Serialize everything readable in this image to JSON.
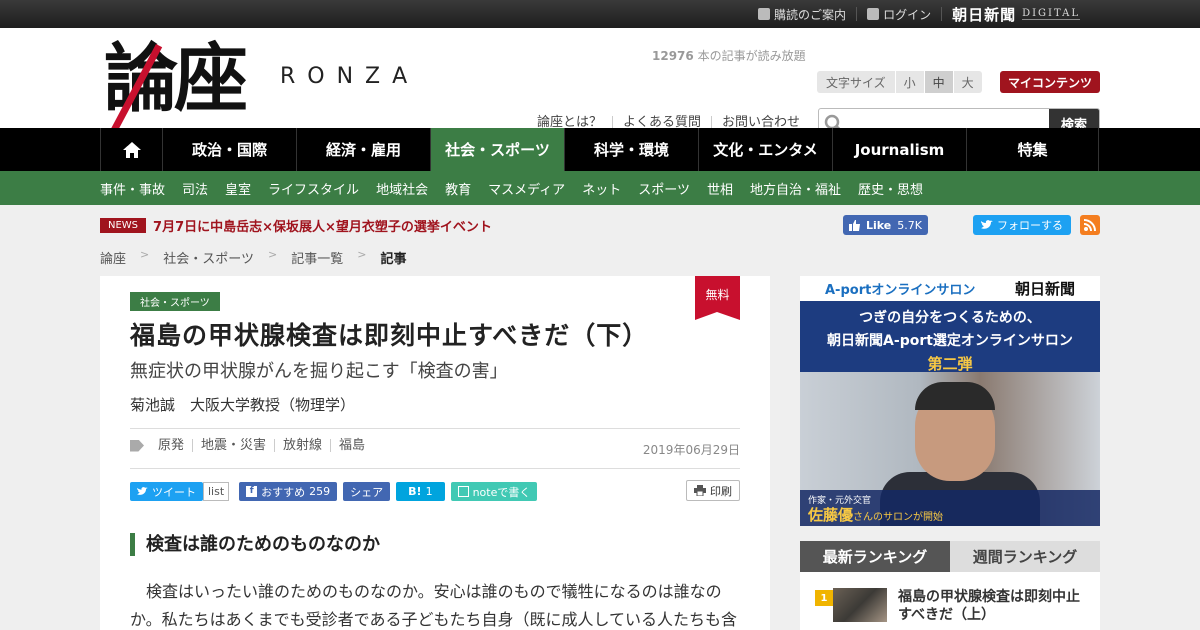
{
  "topbar": {
    "links": [
      "購読のご案内",
      "ログイン"
    ],
    "brand": "朝日新聞",
    "brand_sub": "DIGITAL"
  },
  "header": {
    "logo_kanji": "論座",
    "logo_latin": "RONZA",
    "read_count": "12976",
    "read_count_suffix": " 本の記事が読み放題",
    "font_size_label": "文字サイズ",
    "font_sizes": [
      "小",
      "中",
      "大"
    ],
    "font_size_selected": "中",
    "my_content": "マイコンテンツ",
    "help_links": [
      "論座とは？",
      "よくある質問",
      "お問い合わせ"
    ],
    "search_placeholder": "",
    "search_button": "検索"
  },
  "nav": {
    "items": [
      "政治・国際",
      "経済・雇用",
      "社会・スポーツ",
      "科学・環境",
      "文化・エンタメ",
      "Journalism",
      "特集"
    ],
    "active": "社会・スポーツ"
  },
  "subnav": {
    "items": [
      "事件・事故",
      "司法",
      "皇室",
      "ライフスタイル",
      "地域社会",
      "教育",
      "マスメディア",
      "ネット",
      "スポーツ",
      "世相",
      "地方自治・福祉",
      "歴史・思想"
    ]
  },
  "news": {
    "tag": "NEWS",
    "text": "7月7日に中島岳志×保坂展人×望月衣塑子の選挙イベント"
  },
  "social": {
    "like_label": "Like",
    "like_count": "5.7K",
    "follow_label": "フォローする"
  },
  "breadcrumb": {
    "items": [
      "論座",
      "社会・スポーツ",
      "記事一覧",
      "記事"
    ],
    "separator": ">"
  },
  "article": {
    "category": "社会・スポーツ",
    "free_badge": "無料",
    "title": "福島の甲状腺検査は即刻中止すべきだ（下）",
    "subtitle": "無症状の甲状腺がんを掘り起こす「検査の害」",
    "author": "菊池誠　大阪大学教授（物理学）",
    "tags": [
      "原発",
      "地震・災害",
      "放射線",
      "福島"
    ],
    "date": "2019年06月29日",
    "share": {
      "tweet": "ツイート",
      "list": "list",
      "recommend": "おすすめ",
      "recommend_count": "259",
      "share": "シェア",
      "hatena": "B!",
      "hatena_count": "1",
      "note": "noteで書く",
      "print": "印刷"
    },
    "heading": "検査は誰のためのものなのか",
    "body": "検査はいったい誰のためのものなのか。安心は誰のもので犠牲になるのは誰なのか。私たちはあくまでも受診者である子どもたち自身（既に成人している人たちも含"
  },
  "ad": {
    "top_left": "A-portオンラインサロン",
    "top_right": "朝日新聞",
    "line1": "つぎの自分をつくるための、",
    "line2": "朝日新聞A-port選定オンラインサロン",
    "line3": "第二弾",
    "caption_who": "作家・元外交官",
    "caption_name": "佐藤優",
    "caption_tail": "さんのサロンが開始"
  },
  "ranking": {
    "tabs": [
      "最新ランキング",
      "週間ランキング"
    ],
    "active_tab": "最新ランキング",
    "items": [
      {
        "rank": "1",
        "title": "福島の甲状腺検査は即刻中止すべきだ（上）"
      }
    ]
  },
  "colors": {
    "accent_green": "#3c7d45",
    "brand_red": "#a0141e",
    "twitter_blue": "#1da1f2",
    "facebook_blue": "#4267b2"
  }
}
